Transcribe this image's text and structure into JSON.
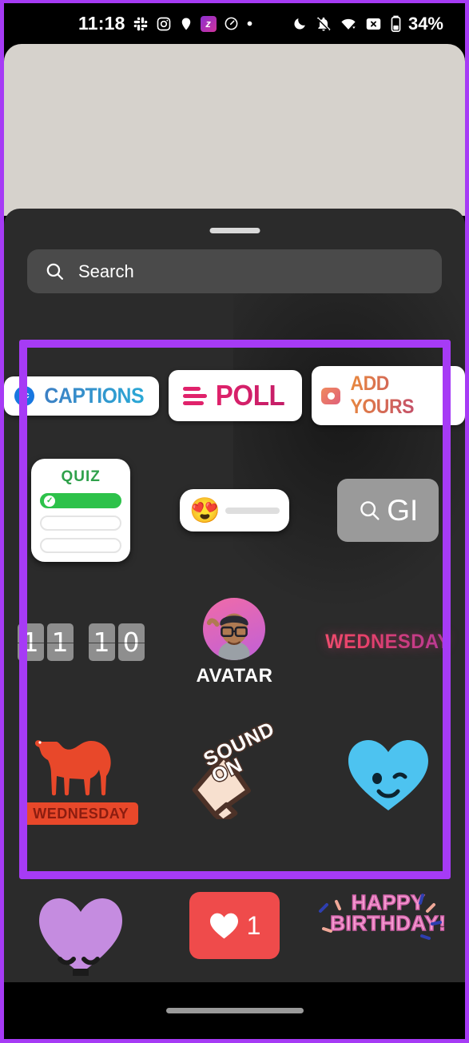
{
  "status_bar": {
    "time": "11:18",
    "left_icons": [
      "slack-icon",
      "instagram-icon",
      "location-pin-icon",
      "zomato-z-icon",
      "clock-icon",
      "dot-icon"
    ],
    "right_icons": [
      "do-not-disturb-moon-icon",
      "notifications-muted-icon",
      "wifi-icon",
      "no-sim-icon"
    ],
    "battery_level": "34%"
  },
  "sheet": {
    "handle": "drag-handle",
    "search": {
      "icon": "search-icon",
      "placeholder": "Search"
    }
  },
  "highlight": {
    "color": "#a63bf5",
    "name": "sticker-grid-highlight"
  },
  "stickers": {
    "row1": [
      {
        "name": "captions-sticker",
        "label": "CAPTIONS",
        "icon": "closed-caption-icon",
        "icon_text": "cc",
        "color": "#2aa9d6"
      },
      {
        "name": "poll-sticker",
        "label": "POLL",
        "icon": "poll-bars-icon",
        "color": "#e0226b"
      },
      {
        "name": "add-yours-sticker",
        "label": "ADD YOURS",
        "icon": "camera-icon",
        "color": "#e98a3d"
      }
    ],
    "row2": {
      "quiz": {
        "name": "quiz-sticker",
        "title": "QUIZ",
        "options": 3,
        "selected_index": 0,
        "color": "#2dc24a"
      },
      "emoji_slider": {
        "name": "emoji-slider-sticker",
        "emoji": "😍",
        "emoji_name": "heart-eyes-emoji"
      },
      "gif": {
        "name": "gif-sticker",
        "label": "GI",
        "icon": "search-icon"
      }
    },
    "row3": {
      "countdown": {
        "name": "countdown-sticker",
        "digits": [
          "1",
          "1",
          "1",
          "0"
        ]
      },
      "avatar": {
        "name": "avatar-sticker",
        "label": "AVATAR"
      },
      "day_text": {
        "name": "wednesday-text-sticker",
        "label": "WEDNESDAY"
      }
    },
    "row4": {
      "camel": {
        "name": "camel-wednesday-sticker",
        "badge_label": "WEDNESDAY",
        "color": "#e8482a"
      },
      "sound_on": {
        "name": "sound-on-sticker",
        "line1": "SOUND",
        "line2": "ON"
      },
      "blue_heart": {
        "name": "winking-blue-heart-sticker",
        "color": "#4dc3f0"
      }
    },
    "row5": {
      "purple_heart": {
        "name": "purple-heart-face-sticker",
        "color": "#c58ce0"
      },
      "like_badge": {
        "name": "like-count-sticker",
        "count": "1",
        "icon": "heart-icon",
        "color": "#ef4b4b"
      },
      "happy_birthday": {
        "name": "happy-birthday-sticker",
        "line1": "HAPPY",
        "line2": "BIRTHDAY!"
      }
    }
  },
  "navigation": {
    "pill": "gesture-nav-pill"
  }
}
